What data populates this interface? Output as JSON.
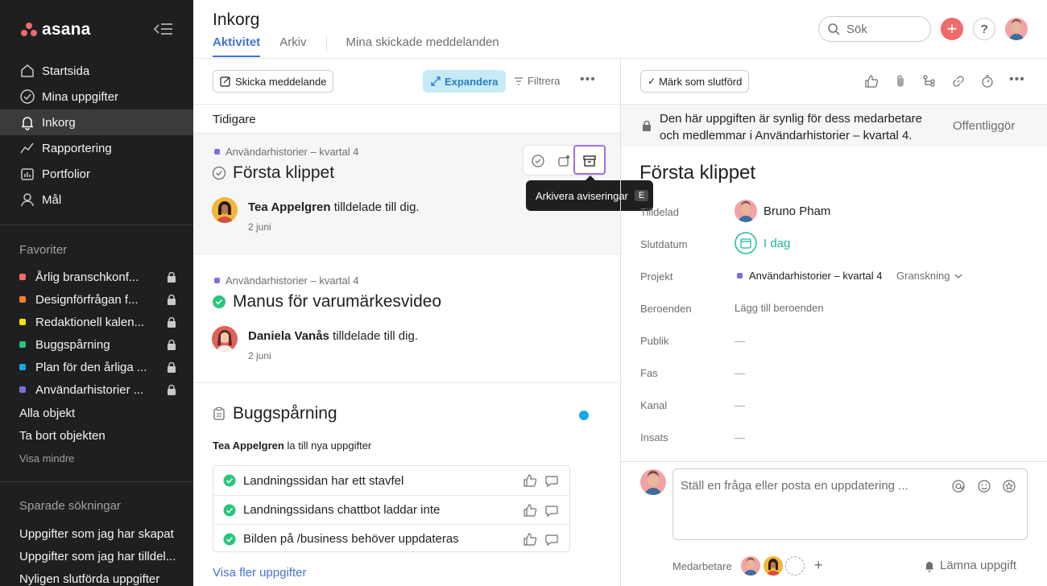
{
  "app": {
    "brand": "asana"
  },
  "sidebar": {
    "nav": [
      {
        "label": "Startsida",
        "icon": "home-icon"
      },
      {
        "label": "Mina uppgifter",
        "icon": "check-circle-icon"
      },
      {
        "label": "Inkorg",
        "icon": "bell-icon",
        "active": true
      },
      {
        "label": "Rapportering",
        "icon": "chart-line-icon"
      },
      {
        "label": "Portfolior",
        "icon": "folder-icon"
      },
      {
        "label": "Mål",
        "icon": "person-icon"
      }
    ],
    "favorites_heading": "Favoriter",
    "favorites": [
      {
        "label": "Årlig branschkonf...",
        "color": "#f06a6a"
      },
      {
        "label": "Designförfrågan f...",
        "color": "#fd7f2b"
      },
      {
        "label": "Redaktionell kalen...",
        "color": "#f8df00"
      },
      {
        "label": "Buggspårning",
        "color": "#2ac57b"
      },
      {
        "label": "Plan för den årliga ...",
        "color": "#14a9e6"
      },
      {
        "label": "Användarhistorier ...",
        "color": "#7b6fe0"
      }
    ],
    "all_objects": "Alla objekt",
    "delete_objects": "Ta bort objekten",
    "show_less": "Visa mindre",
    "saved_searches_heading": "Sparade sökningar",
    "saved_searches": [
      "Uppgifter som jag har skapat",
      "Uppgifter som jag har tilldel...",
      "Nyligen slutförda uppgifter"
    ]
  },
  "header": {
    "title": "Inkorg",
    "tabs": [
      "Aktivitet",
      "Arkiv",
      "Mina skickade meddelanden"
    ],
    "search_placeholder": "Sök",
    "help": "?"
  },
  "inbox": {
    "send_message": "Skicka meddelande",
    "expand": "Expandera",
    "filter": "Filtrera",
    "earlier": "Tidigare",
    "tooltip": "Arkivera aviseringar",
    "tooltip_key": "E",
    "items": [
      {
        "project": "Användarhistorier – kvartal 4",
        "title": "Första klippet",
        "actor": "Tea Appelgren",
        "action": "tilldelade till dig.",
        "date": "2 juni"
      },
      {
        "project": "Användarhistorier – kvartal 4",
        "title": "Manus för varumärkesvideo",
        "actor": "Daniela Vanås",
        "action": "tilldelade till dig.",
        "date": "2 juni"
      }
    ],
    "bug": {
      "title": "Buggspårning",
      "actor": "Tea Appelgren",
      "action": "la till nya uppgifter",
      "tasks": [
        "Landningssidan har ett stavfel",
        "Landningssidans chattbot laddar inte",
        "Bilden på /business behöver uppdateras"
      ],
      "show_more": "Visa fler uppgifter"
    }
  },
  "detail": {
    "mark_done": "Märk som slutförd",
    "visibility": "Den här uppgiften är synlig för dess medarbetare och medlemmar i Användarhistorier – kvartal 4.",
    "visibility_line1": "Den här uppgiften är synlig för dess medarbetare",
    "visibility_line2": "och medlemmar i Användarhistorier – kvartal 4.",
    "publish": "Offentliggör",
    "title": "Första klippet",
    "fields": {
      "assignee_label": "Tilldelad",
      "assignee": "Bruno Pham",
      "due_label": "Slutdatum",
      "due": "I dag",
      "project_label": "Projekt",
      "project": "Användarhistorier – kvartal 4",
      "section": "Granskning",
      "deps_label": "Beroenden",
      "deps": "Lägg till beroenden",
      "audience_label": "Publik",
      "phase_label": "Fas",
      "channel_label": "Kanal",
      "effort_label": "Insats",
      "empty": "—"
    },
    "composer_placeholder": "Ställ en fråga eller posta en uppdatering ...",
    "collaborators_label": "Medarbetare",
    "leave": "Lämna uppgift"
  }
}
